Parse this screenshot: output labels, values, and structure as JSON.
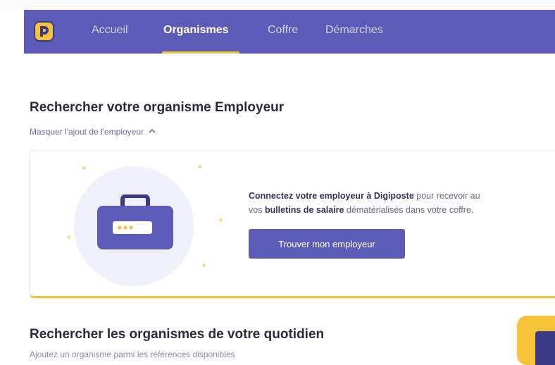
{
  "nav": {
    "items": [
      {
        "label": "Accueil",
        "active": false
      },
      {
        "label": "Organismes",
        "active": true
      },
      {
        "label": "Coffre",
        "active": false
      },
      {
        "label": "Démarches",
        "active": false
      }
    ]
  },
  "employer_section": {
    "title": "Rechercher votre organisme Employeur",
    "toggle_label": "Masquer l'ajout de l'employeur",
    "toggle_icon": "chevron-up-icon",
    "card": {
      "text_strong_1": "Connectez votre employeur à Digiposte",
      "text_1": " pour recevoir au",
      "text_2": "vos ",
      "text_strong_2": "bulletins de salaire",
      "text_3": " dématérialisés dans votre coffre.",
      "button_label": "Trouver mon employeur",
      "icon": "briefcase-icon"
    }
  },
  "daily_section": {
    "title": "Rechercher les organismes de votre quotidien",
    "subtitle": "Ajoutez un organisme parmi les références disponibles"
  },
  "colors": {
    "nav_bg": "#5c5bb7",
    "accent_yellow": "#f6c338",
    "brand_dark": "#3b3a86",
    "button_bg": "#5c5bb7"
  }
}
